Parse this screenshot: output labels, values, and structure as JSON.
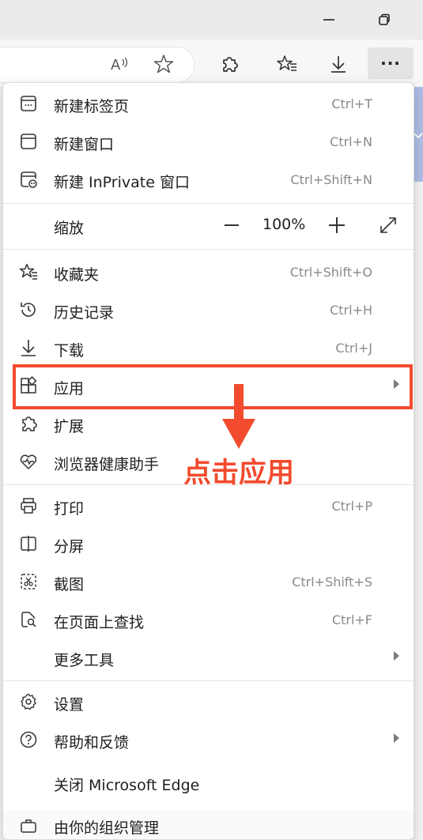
{
  "toolbar": {
    "read_aloud_icon": "A",
    "more_label": "···"
  },
  "menu": {
    "new_tab": {
      "label": "新建标签页",
      "shortcut": "Ctrl+T"
    },
    "new_window": {
      "label": "新建窗口",
      "shortcut": "Ctrl+N"
    },
    "new_inprivate": {
      "label": "新建 InPrivate 窗口",
      "shortcut": "Ctrl+Shift+N"
    },
    "zoom": {
      "label": "缩放",
      "value": "100%"
    },
    "favorites": {
      "label": "收藏夹",
      "shortcut": "Ctrl+Shift+O"
    },
    "history": {
      "label": "历史记录",
      "shortcut": "Ctrl+H"
    },
    "downloads": {
      "label": "下载",
      "shortcut": "Ctrl+J"
    },
    "apps": {
      "label": "应用"
    },
    "extensions": {
      "label": "扩展"
    },
    "browser_health": {
      "label": "浏览器健康助手"
    },
    "print": {
      "label": "打印",
      "shortcut": "Ctrl+P"
    },
    "split_screen": {
      "label": "分屏"
    },
    "screenshot": {
      "label": "截图",
      "shortcut": "Ctrl+Shift+S"
    },
    "find": {
      "label": "在页面上查找",
      "shortcut": "Ctrl+F"
    },
    "more_tools": {
      "label": "更多工具"
    },
    "settings": {
      "label": "设置"
    },
    "help": {
      "label": "帮助和反馈"
    },
    "close_edge": {
      "label": "关闭 Microsoft Edge"
    },
    "managed": {
      "label": "由你的组织管理"
    }
  },
  "annotation": {
    "text": "点击应用",
    "color": "#f24b2e"
  },
  "colors": {
    "highlight": "#f24b2e",
    "menu_bg": "#ffffff",
    "background_accent": "#aebde6"
  }
}
